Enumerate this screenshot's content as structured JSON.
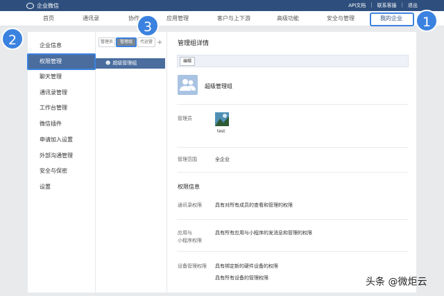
{
  "app": {
    "title": "企业微信"
  },
  "top_links": [
    "API文档",
    "联系客服",
    "退出"
  ],
  "nav": [
    "首页",
    "通讯录",
    "协作",
    "应用管理",
    "客户与上下游",
    "高级功能",
    "安全与管理",
    "我的企业"
  ],
  "sidebar": [
    "企业信息",
    "权限管理",
    "聊天管理",
    "通讯录管理",
    "工作台管理",
    "微信插件",
    "申请加入设置",
    "外部沟通管理",
    "安全与保密",
    "设置"
  ],
  "tabs": [
    "管理员",
    "管理组",
    "代运营"
  ],
  "plus": "+",
  "group_item": {
    "icon": "group-icon",
    "label": "超级管理组"
  },
  "detail": {
    "title": "管理组详情",
    "edit_label": "编辑",
    "group_name": "超级管理组",
    "admins_label": "管理员",
    "admin_name": "test",
    "scope_label": "管理范围",
    "scope_value": "全企业",
    "perm_title": "权限信息",
    "perms": [
      {
        "label": "通讯录权限",
        "value": "具有对所有成员的查看和管理的权限"
      },
      {
        "label_line1": "应用与",
        "label_line2": "小程序权限",
        "value": "具有所有应用与小程序的发消息和管理的权限"
      },
      {
        "label": "设备管理权限",
        "value": "具有绑定新的硬件设备的权限",
        "value2": "具有所有设备的管理权限"
      }
    ]
  },
  "badges": [
    "1",
    "2",
    "3"
  ],
  "watermark": "头条 @微炬云",
  "colors": {
    "topbar": "#2e4f7d",
    "accent": "#3b82e0",
    "selected": "#4a6d9e"
  }
}
